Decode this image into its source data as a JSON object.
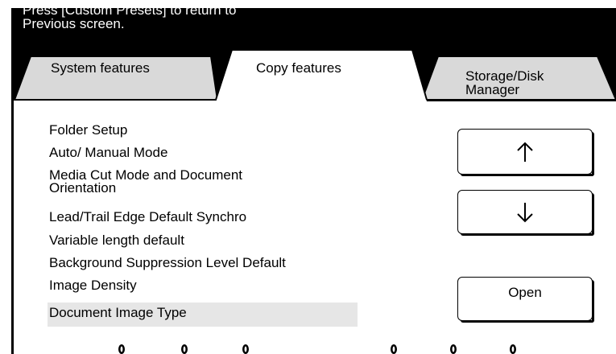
{
  "header": {
    "message": "Press [Custom Presets] to return to\nPrevious screen."
  },
  "tabs": [
    {
      "label": "System features",
      "active": false
    },
    {
      "label": "Copy features",
      "active": true
    },
    {
      "label": "Storage/Disk\nManager",
      "active": false
    }
  ],
  "menu": {
    "items": [
      {
        "label": "Folder Setup"
      },
      {
        "label": "Auto/ Manual Mode"
      },
      {
        "label": "Media Cut Mode and Document\nOrientation"
      },
      {
        "label": "Lead/Trail Edge Default Synchro"
      },
      {
        "label": "Variable length default"
      },
      {
        "label": "Background Suppression Level Default"
      },
      {
        "label": "Image Density"
      },
      {
        "label": "Document Image Type",
        "selected": true
      }
    ]
  },
  "buttons": {
    "scroll_up_icon": "arrow-up-icon",
    "scroll_down_icon": "arrow-down-icon",
    "open_label": "Open"
  },
  "colors": {
    "background": "#000000",
    "tab_inactive": "#d9d9d9",
    "selected_row": "#e6e6e6"
  }
}
